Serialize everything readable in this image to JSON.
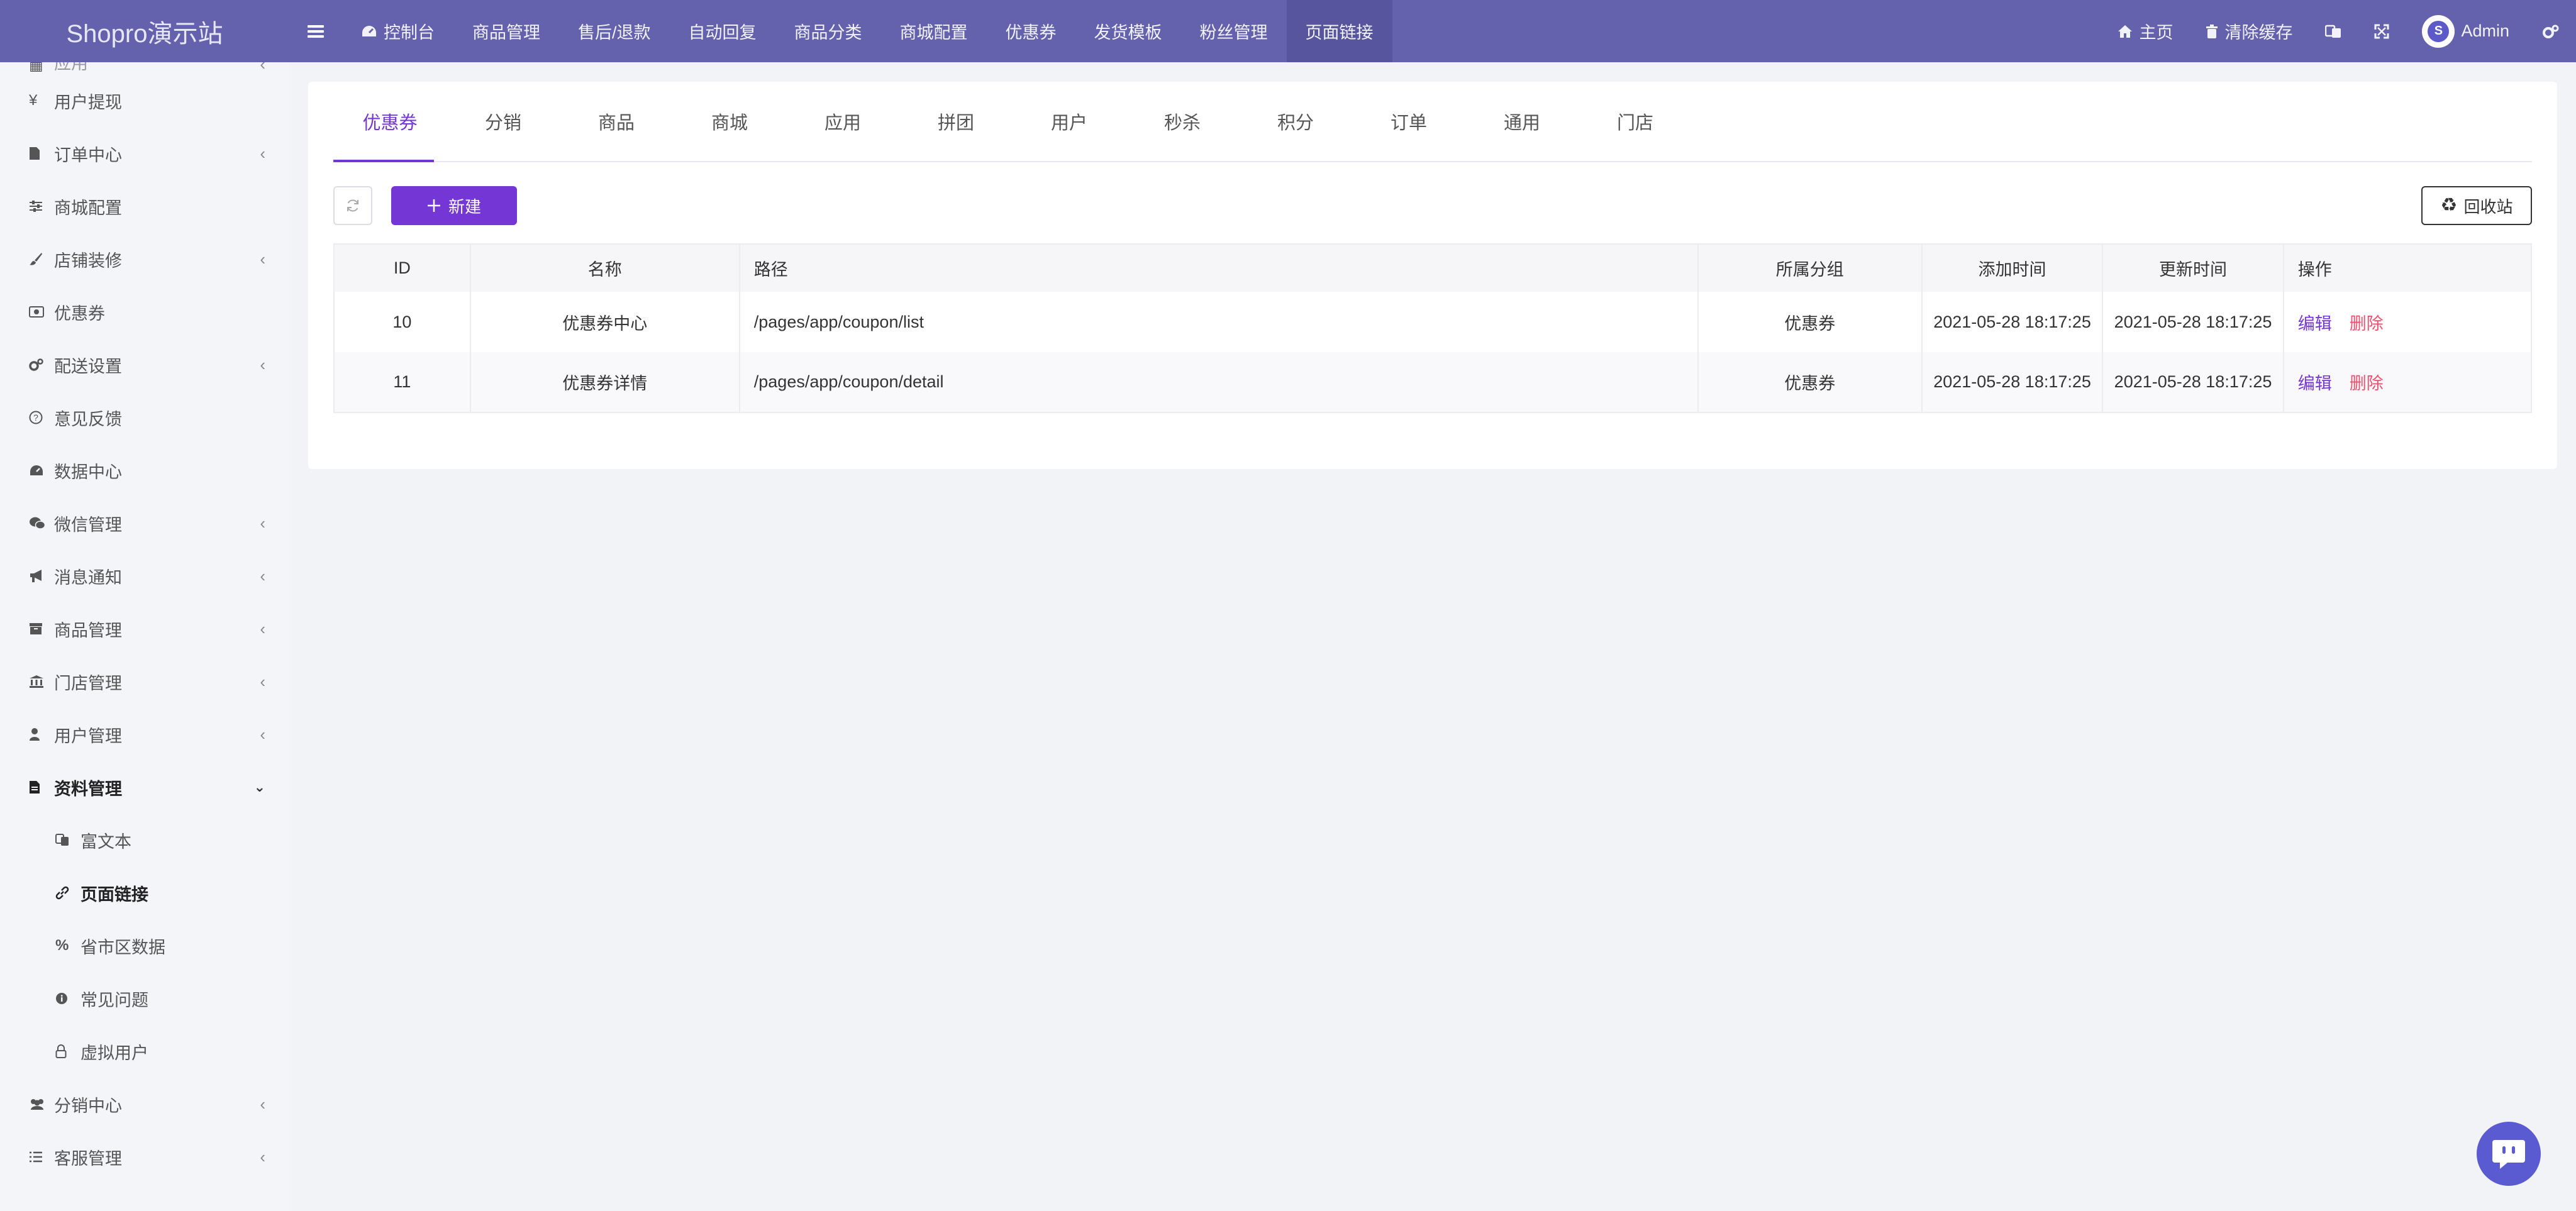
{
  "brand": "Shopro演示站",
  "top_menu": [
    {
      "label": "控制台",
      "icon": "dashboard-icon"
    },
    {
      "label": "商品管理"
    },
    {
      "label": "售后/退款"
    },
    {
      "label": "自动回复"
    },
    {
      "label": "商品分类"
    },
    {
      "label": "商城配置"
    },
    {
      "label": "优惠券"
    },
    {
      "label": "发货模板"
    },
    {
      "label": "粉丝管理"
    },
    {
      "label": "页面链接",
      "active": true
    }
  ],
  "top_right": {
    "home": "主页",
    "clear_cache": "清除缓存",
    "user": "Admin"
  },
  "sidebar": {
    "partial_top": "应用",
    "items": [
      {
        "label": "用户提现",
        "icon": "yen-icon"
      },
      {
        "label": "订单中心",
        "icon": "file-icon",
        "arrow": true
      },
      {
        "label": "商城配置",
        "icon": "sliders-icon"
      },
      {
        "label": "店铺装修",
        "icon": "brush-icon",
        "arrow": true
      },
      {
        "label": "优惠券",
        "icon": "money-icon"
      },
      {
        "label": "配送设置",
        "icon": "gears-icon",
        "arrow": true
      },
      {
        "label": "意见反馈",
        "icon": "question-icon"
      },
      {
        "label": "数据中心",
        "icon": "dashboard-icon"
      },
      {
        "label": "微信管理",
        "icon": "wechat-icon",
        "arrow": true
      },
      {
        "label": "消息通知",
        "icon": "bullhorn-icon",
        "arrow": true
      },
      {
        "label": "商品管理",
        "icon": "archive-icon",
        "arrow": true
      },
      {
        "label": "门店管理",
        "icon": "bank-icon",
        "arrow": true
      },
      {
        "label": "用户管理",
        "icon": "user-icon",
        "arrow": true
      },
      {
        "label": "资料管理",
        "icon": "file-text-icon",
        "arrow": true,
        "expanded": true
      }
    ],
    "sub_items": [
      {
        "label": "富文本",
        "icon": "language-icon"
      },
      {
        "label": "页面链接",
        "icon": "link-icon",
        "active": true
      },
      {
        "label": "省市区数据",
        "icon": "percent-icon"
      },
      {
        "label": "常见问题",
        "icon": "info-icon"
      },
      {
        "label": "虚拟用户",
        "icon": "lock-icon"
      }
    ],
    "bottom_items": [
      {
        "label": "分销中心",
        "icon": "users-icon",
        "arrow": true
      },
      {
        "label": "客服管理",
        "icon": "list-icon",
        "arrow": true
      }
    ]
  },
  "tabs": [
    "优惠券",
    "分销",
    "商品",
    "商城",
    "应用",
    "拼团",
    "用户",
    "秒杀",
    "积分",
    "订单",
    "通用",
    "门店"
  ],
  "active_tab": 0,
  "toolbar": {
    "new_label": "新建",
    "recycle_label": "回收站"
  },
  "table": {
    "headers": [
      "ID",
      "名称",
      "路径",
      "所属分组",
      "添加时间",
      "更新时间",
      "操作"
    ],
    "rows": [
      {
        "id": "10",
        "name": "优惠券中心",
        "path": "/pages/app/coupon/list",
        "group": "优惠券",
        "created": "2021-05-28 18:17:25",
        "updated": "2021-05-28 18:17:25"
      },
      {
        "id": "11",
        "name": "优惠券详情",
        "path": "/pages/app/coupon/detail",
        "group": "优惠券",
        "created": "2021-05-28 18:17:25",
        "updated": "2021-05-28 18:17:25"
      }
    ],
    "edit_label": "编辑",
    "delete_label": "删除"
  },
  "colors": {
    "navbar": "#6462ad",
    "primary": "#7536d6",
    "danger": "#f0506e",
    "chat": "#5a5ad1"
  }
}
